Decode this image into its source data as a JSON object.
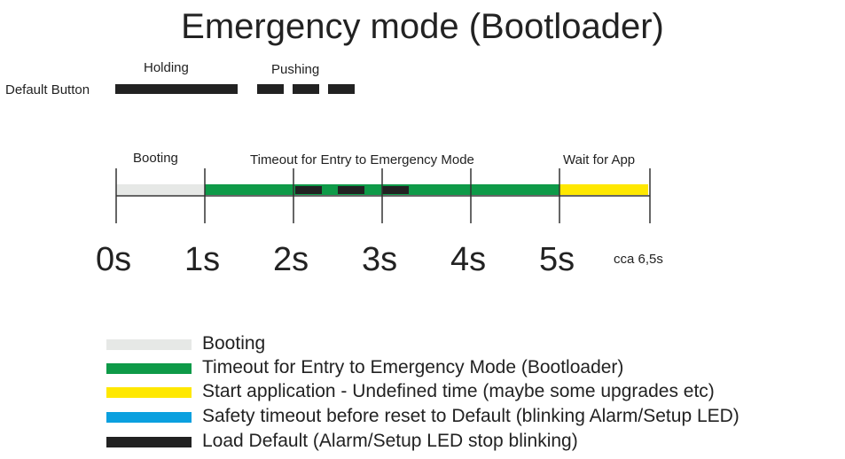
{
  "title": "Emergency mode (Bootloader)",
  "button_row": {
    "label": "Default Button",
    "holding_label": "Holding",
    "pushing_label": "Pushing"
  },
  "phases": {
    "booting": "Booting",
    "timeout": "Timeout for Entry to Emergency Mode",
    "wait": "Wait for App"
  },
  "ticks": [
    "0s",
    "1s",
    "2s",
    "3s",
    "4s",
    "5s"
  ],
  "end_tick": "cca 6,5s",
  "legend": [
    {
      "label": "Booting",
      "color": "#e6e8e6"
    },
    {
      "label": "Timeout for Entry to Emergency Mode (Bootloader)",
      "color": "#0e9a48"
    },
    {
      "label": "Start application - Undefined time (maybe some upgrades etc)",
      "color": "#ffe800"
    },
    {
      "label": "Safety timeout before reset to Default  (blinking Alarm/Setup LED)",
      "color": "#0aa0df"
    },
    {
      "label": "Load Default (Alarm/Setup LED stop blinking)",
      "color": "#222222"
    }
  ],
  "colors": {
    "booting": "#e6e8e6",
    "timeout": "#0e9a48",
    "wait": "#ffe800",
    "dark": "#222222"
  }
}
